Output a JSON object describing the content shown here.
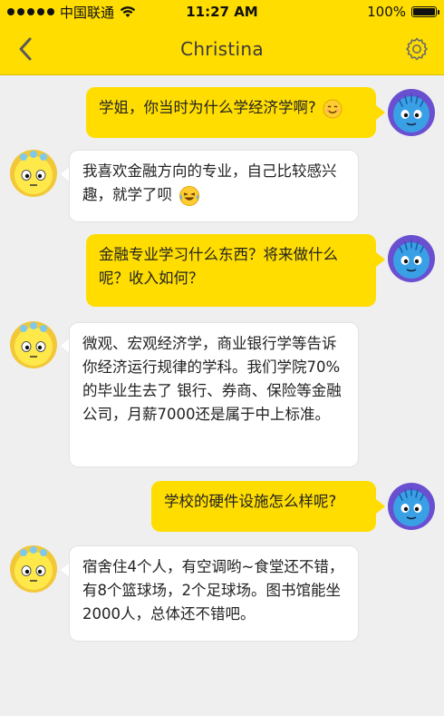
{
  "status_bar": {
    "carrier": "中国联通",
    "time": "11:27 AM",
    "battery": "100%",
    "battery_level": 1.0
  },
  "header": {
    "title": "Christina",
    "back_icon": "chevron-left-icon",
    "settings_icon": "gear-icon"
  },
  "colors": {
    "accent": "#ffdd00",
    "background": "#efefef",
    "incoming_bubble": "#ffffff",
    "self_avatar": "#3aa0e6",
    "self_avatar_ring": "#6a4fd0",
    "contact_avatar": "#ffe94a"
  },
  "messages": [
    {
      "from": "me",
      "text": "学姐，你当时为什么学经济学啊?",
      "emoji": "smiling-face-emoji"
    },
    {
      "from": "contact",
      "text": "我喜欢金融方向的专业，自己比较感兴趣，就学了呗",
      "emoji": "laughing-tears-emoji"
    },
    {
      "from": "me",
      "text": "金融专业学习什么东西？将来做什么呢？收入如何？"
    },
    {
      "from": "contact",
      "text": "微观、宏观经济学，商业银行学等告诉你经济运行规律的学科。我们学院70%的毕业生去了 银行、券商、保险等金融公司，月薪7000还是属于中上标准。"
    },
    {
      "from": "me",
      "text": "学校的硬件设施怎么样呢?"
    },
    {
      "from": "contact",
      "text": "宿舍住4个人，有空调哟~食堂还不错，有8个篮球场，2个足球场。图书馆能坐2000人，总体还不错吧。"
    }
  ]
}
